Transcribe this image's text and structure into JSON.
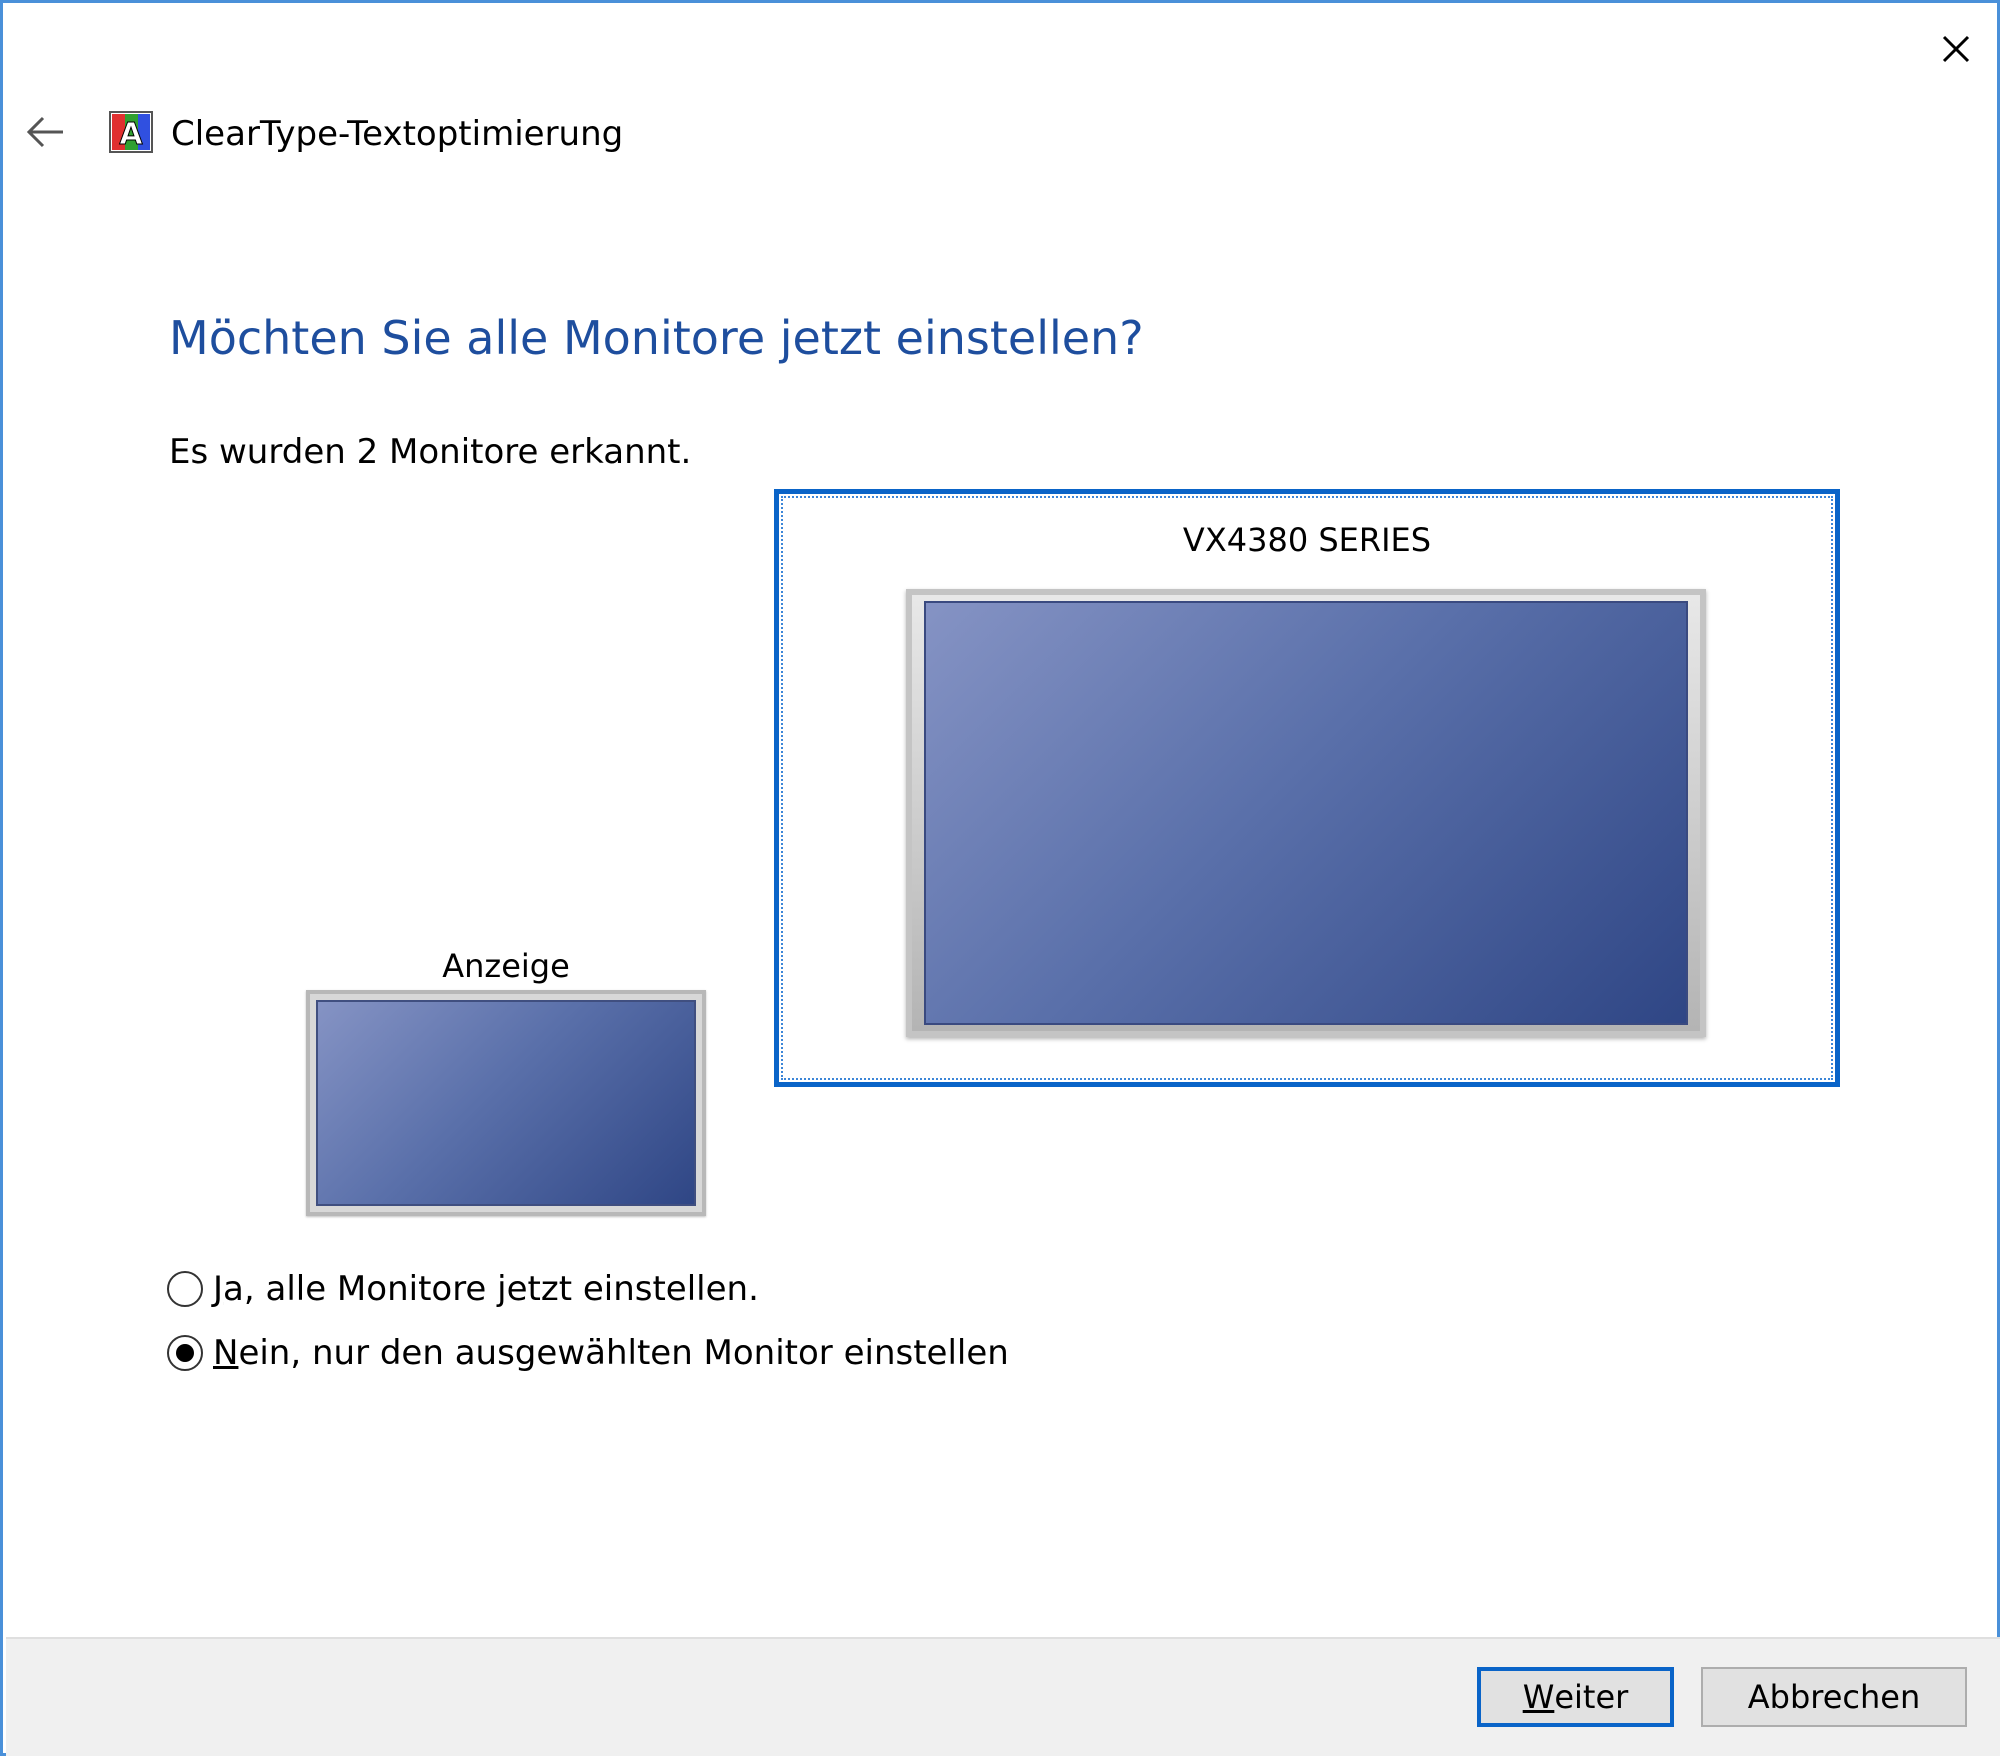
{
  "window": {
    "title": "ClearType-Textoptimierung",
    "close_icon": "close-icon",
    "back_icon": "arrow-left-icon",
    "app_icon": "cleartype-icon",
    "app_icon_letter": "A"
  },
  "content": {
    "heading": "Möchten Sie alle Monitore jetzt einstellen?",
    "detected_text": "Es wurden 2 Monitore erkannt."
  },
  "monitors": [
    {
      "label": "Anzeige",
      "selected": false
    },
    {
      "label": "VX4380 SERIES",
      "selected": true
    }
  ],
  "options": [
    {
      "mnemonic": "J",
      "rest": "a, alle Monitore jetzt einstellen.",
      "checked": false
    },
    {
      "mnemonic": "N",
      "rest": "ein, nur den ausgewählten Monitor einstellen",
      "checked": true
    }
  ],
  "buttons": {
    "next": {
      "mnemonic": "W",
      "rest": "eiter"
    },
    "cancel": {
      "label": "Abbrechen"
    }
  },
  "colors": {
    "accent": "#0a64c8",
    "heading": "#1e4e9e",
    "window_border": "#4a90d9",
    "footer_bg": "#f0f0f0"
  }
}
